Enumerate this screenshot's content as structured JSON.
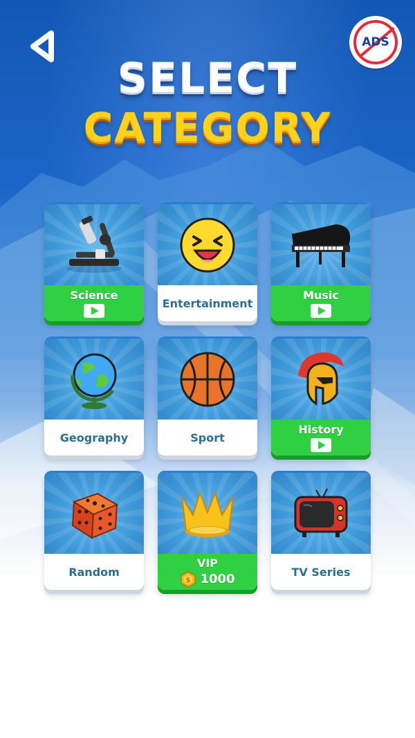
{
  "header": {
    "title_line1": "SELECT",
    "title_line2": "CATEGORY",
    "ads_label": "ADS"
  },
  "categories": [
    {
      "label": "Science",
      "icon": "microscope-icon",
      "locked_video": true
    },
    {
      "label": "Entertainment",
      "icon": "laughing-emoji-icon",
      "locked_video": false
    },
    {
      "label": "Music",
      "icon": "grand-piano-icon",
      "locked_video": true
    },
    {
      "label": "Geography",
      "icon": "globe-icon",
      "locked_video": false
    },
    {
      "label": "Sport",
      "icon": "basketball-icon",
      "locked_video": false
    },
    {
      "label": "History",
      "icon": "spartan-helmet-icon",
      "locked_video": true
    },
    {
      "label": "Random",
      "icon": "dice-icon",
      "locked_video": false
    },
    {
      "label": "VIP",
      "icon": "crown-icon",
      "price": "1000",
      "price_icon": "coin-icon"
    },
    {
      "label": "TV Series",
      "icon": "retro-tv-icon",
      "locked_video": false
    }
  ],
  "colors": {
    "bg_top": "#1357b4",
    "title_white": "#ffffff",
    "title_yellow": "#ffd21c",
    "card_art_blue": "#3f9ad9",
    "locked_green": "#2fd041",
    "label_blue": "#2a6f95"
  }
}
